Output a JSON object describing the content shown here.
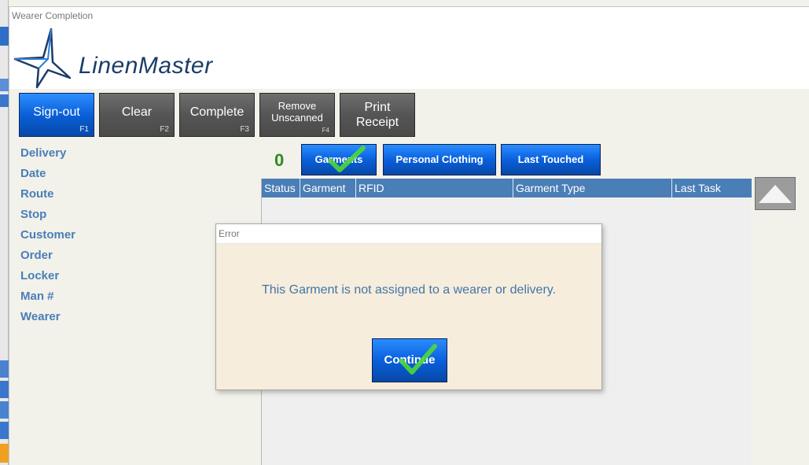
{
  "window": {
    "title": "Wearer Completion"
  },
  "brand": {
    "logo_text": "LinenMaster"
  },
  "toolbar": {
    "signout": {
      "label": "Sign-out",
      "key": "F1"
    },
    "clear": {
      "label": "Clear",
      "key": "F2"
    },
    "complete": {
      "label": "Complete",
      "key": "F3"
    },
    "remove": {
      "line1": "Remove",
      "line2": "Unscanned",
      "key": "F4"
    },
    "print": {
      "line1": "Print",
      "line2": "Receipt"
    }
  },
  "fields": [
    "Delivery",
    "Date",
    "Route",
    "Stop",
    "Customer",
    "Order",
    "Locker",
    "Man #",
    "Wearer"
  ],
  "main": {
    "count": "0",
    "filters": {
      "garments": "Garments",
      "personal": "Personal Clothing",
      "last_touched": "Last Touched"
    },
    "columns": [
      "Status",
      "Garment",
      "RFID",
      "Garment Type",
      "Last Task"
    ]
  },
  "dialog": {
    "title": "Error",
    "message": "This Garment is not assigned to a wearer or delivery.",
    "button": "Continue"
  },
  "colors": {
    "accent_blue": "#0a60dc",
    "label_blue": "#4a7eb8",
    "count_green": "#2f8a24",
    "dialog_bg": "#f7eddc"
  }
}
